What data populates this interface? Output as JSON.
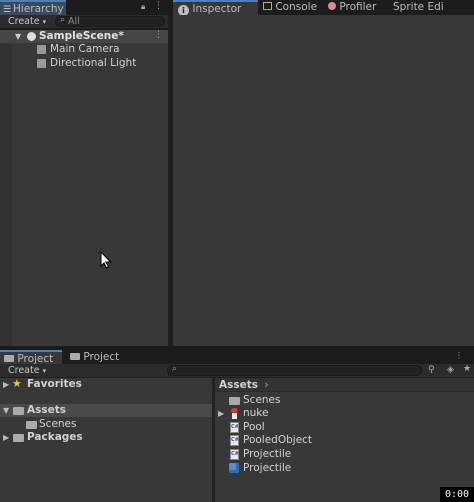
{
  "hierarchy": {
    "tab_label": "Hierarchy",
    "create_label": "Create",
    "search_placeholder": "All",
    "scene_name": "SampleScene*",
    "items": [
      {
        "label": "Main Camera"
      },
      {
        "label": "Directional Light"
      }
    ]
  },
  "inspector_tabs": [
    {
      "label": "Inspector"
    },
    {
      "label": "Console"
    },
    {
      "label": "Profiler"
    },
    {
      "label": "Sprite Edi"
    }
  ],
  "project": {
    "tabs": [
      {
        "label": "Project"
      },
      {
        "label": "Project"
      }
    ],
    "create_label": "Create",
    "sidebar": {
      "favorites": "Favorites",
      "assets": "Assets",
      "scenes": "Scenes",
      "packages": "Packages"
    },
    "breadcrumb": "Assets",
    "assets": [
      {
        "label": "Scenes",
        "icon": "folder-icon"
      },
      {
        "label": "nuke",
        "icon": "prefab-character-icon"
      },
      {
        "label": "Pool",
        "icon": "csharp-script-icon"
      },
      {
        "label": "PooledObject",
        "icon": "csharp-script-icon"
      },
      {
        "label": "Projectile",
        "icon": "csharp-script-icon"
      },
      {
        "label": "Projectile",
        "icon": "prefab-cube-icon"
      }
    ]
  },
  "timer": "0:00",
  "colors": {
    "panel": "#383838",
    "toolbar": "#2c2c2c",
    "selected_tab": "#3d4f66",
    "selected_row": "#464646",
    "text": "#d2d2d2"
  }
}
